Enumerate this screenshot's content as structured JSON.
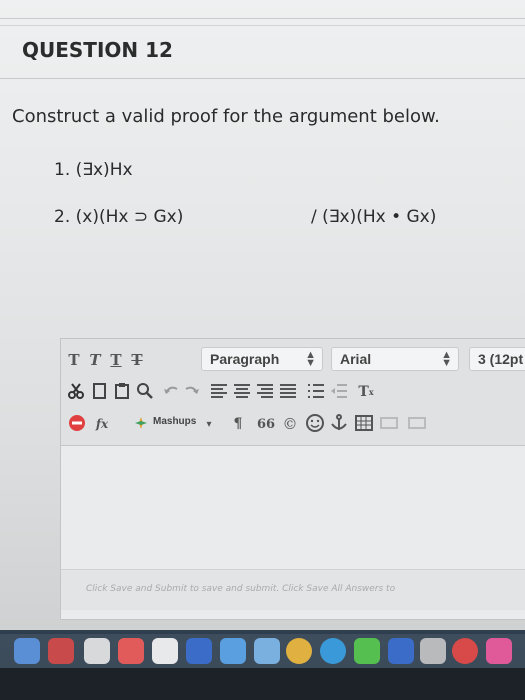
{
  "question": {
    "title": "QUESTION 12",
    "prompt": "Construct a valid proof for the argument below.",
    "premises": [
      "1. (∃x)Hx",
      "2. (x)(Hx ⊃ Gx)"
    ],
    "conclusion": "/ (∃x)(Hx • Gx)"
  },
  "editor": {
    "toolbar": {
      "text_style_buttons": [
        "T",
        "T",
        "T",
        "T"
      ],
      "paragraph_select": "Paragraph",
      "font_select": "Arial",
      "size_select": "3 (12pt",
      "mashups_label": "Mashups",
      "superscript_label": "T",
      "formula_label": "fx",
      "quote_label": "66",
      "pilcrow_label": "¶",
      "copyright_label": "©"
    },
    "status_text": "Click Save and Submit to save and submit. Click Save All Answers to"
  },
  "icons": [
    "cut-icon",
    "copy-icon",
    "paste-icon",
    "search-icon",
    "undo-icon",
    "redo-icon",
    "align-left-icon",
    "align-center-icon",
    "align-right-icon",
    "justify-icon",
    "list-icon",
    "outdent-icon",
    "spellcheck-icon",
    "formula-icon",
    "mashups-icon",
    "emoji-icon",
    "anchor-icon",
    "table-icon"
  ],
  "colors": {
    "spellcheck": "#e04040",
    "dock": "#2a3948"
  }
}
